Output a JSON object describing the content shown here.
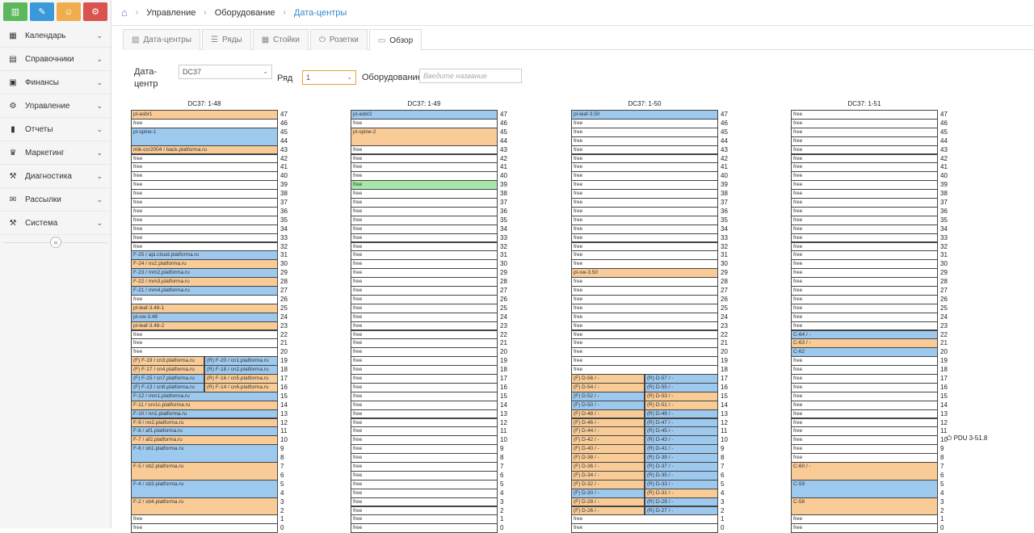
{
  "shortcuts": [
    {
      "icon": "chart-icon",
      "color": "#5cb85c"
    },
    {
      "icon": "pencil-icon",
      "color": "#3a9ad9"
    },
    {
      "icon": "users-icon",
      "color": "#f0ad4e"
    },
    {
      "icon": "gears-icon",
      "color": "#d9534f"
    }
  ],
  "sidebar": {
    "items": [
      {
        "label": "Календарь",
        "icon": "calendar-icon"
      },
      {
        "label": "Справочники",
        "icon": "book-icon"
      },
      {
        "label": "Финансы",
        "icon": "money-icon"
      },
      {
        "label": "Управление",
        "icon": "cogs-icon"
      },
      {
        "label": "Отчеты",
        "icon": "bar-chart-icon"
      },
      {
        "label": "Маркетинг",
        "icon": "trophy-icon"
      },
      {
        "label": "Диагностика",
        "icon": "gavel-icon"
      },
      {
        "label": "Рассылки",
        "icon": "envelope-icon"
      },
      {
        "label": "Система",
        "icon": "wrench-icon"
      }
    ],
    "collapse": "«"
  },
  "breadcrumb": [
    "Управление",
    "Оборудование",
    "Дата-центры"
  ],
  "tabs": [
    {
      "label": "Дата-центры",
      "icon": "image-icon"
    },
    {
      "label": "Ряды",
      "icon": "list-icon"
    },
    {
      "label": "Стойки",
      "icon": "grid-icon"
    },
    {
      "label": "Розетки",
      "icon": "power-icon"
    },
    {
      "label": "Обзор",
      "icon": "monitor-icon",
      "active": true
    }
  ],
  "filters": {
    "dc_label": "Дата-",
    "dc_label2": "центр",
    "dc_value": "DC37",
    "row_label": "Ряд",
    "row_value": "1",
    "equip_label": "Оборудование",
    "equip_placeholder": "Введите название"
  },
  "racks": [
    {
      "title": "DC37: 1-48",
      "units": [
        {
          "n": 47,
          "t": "pl-asbr1",
          "c": "orange"
        },
        {
          "n": 46,
          "t": "free",
          "c": "free"
        },
        {
          "n": 45,
          "t": "pl-spine-1",
          "c": "blue",
          "span": 2
        },
        {
          "n": 43,
          "t": "mik-ccr2004 / back.platforma.ru",
          "c": "orange"
        },
        {
          "n": 42,
          "t": "free",
          "c": "free"
        },
        {
          "n": 41,
          "t": "free",
          "c": "free"
        },
        {
          "n": 40,
          "t": "free",
          "c": "free"
        },
        {
          "n": 39,
          "t": "free",
          "c": "free"
        },
        {
          "n": 38,
          "t": "free",
          "c": "free"
        },
        {
          "n": 37,
          "t": "free",
          "c": "free"
        },
        {
          "n": 36,
          "t": "free",
          "c": "free"
        },
        {
          "n": 35,
          "t": "free",
          "c": "free"
        },
        {
          "n": 34,
          "t": "free",
          "c": "free"
        },
        {
          "n": 33,
          "t": "free",
          "c": "free"
        },
        {
          "n": 32,
          "t": "free",
          "c": "free"
        },
        {
          "n": 31,
          "t": "F-25 / api.cloud.platforma.ru",
          "c": "blue"
        },
        {
          "n": 30,
          "t": "F-24 / ns2.platforma.ru",
          "c": "orange"
        },
        {
          "n": 29,
          "t": "F-23 / mm2.platforma.ru",
          "c": "blue"
        },
        {
          "n": 28,
          "t": "F-22 / mm3.platforma.ru",
          "c": "orange"
        },
        {
          "n": 27,
          "t": "F-21 / mm4.platforma.ru",
          "c": "blue"
        },
        {
          "n": 26,
          "t": "free",
          "c": "free"
        },
        {
          "n": 25,
          "t": "pl-leaf-3.48-1",
          "c": "orange"
        },
        {
          "n": 24,
          "t": "pl-sw-3.48",
          "c": "blue"
        },
        {
          "n": 23,
          "t": "pl-leaf-3.48-2",
          "c": "orange"
        },
        {
          "n": 22,
          "t": "free",
          "c": "free"
        },
        {
          "n": 21,
          "t": "free",
          "c": "free"
        },
        {
          "n": 20,
          "t": "free",
          "c": "free"
        },
        {
          "n": 19,
          "t": "(F) F-19 / cn3.platforma.ru",
          "c": "orange",
          "r": "(R) F-20 / cn1.platforma.ru",
          "rc": "blue"
        },
        {
          "n": 18,
          "t": "(F) F-17 / cn4.platforma.ru",
          "c": "orange",
          "r": "(R) F-18 / cn2.platforma.ru",
          "rc": "blue"
        },
        {
          "n": 17,
          "t": "(F) F-15 / cn7.platforma.ru",
          "c": "blue",
          "r": "(R) F-16 / cn5.platforma.ru",
          "rc": "orange"
        },
        {
          "n": 16,
          "t": "(F) F-13 / cn8.platforma.ru",
          "c": "blue",
          "r": "(R) F-14 / cn6.platforma.ru",
          "rc": "orange"
        },
        {
          "n": 15,
          "t": "F-12 / mm1.platforma.ru",
          "c": "blue"
        },
        {
          "n": 14,
          "t": "F-11 / srv1c.platforma.ru",
          "c": "orange"
        },
        {
          "n": 13,
          "t": "F-10 / nn1.platforma.ru",
          "c": "blue"
        },
        {
          "n": 12,
          "t": "F-9 / nn2.platforma.ru",
          "c": "orange"
        },
        {
          "n": 11,
          "t": "F-8 / af1.platforma.ru",
          "c": "blue"
        },
        {
          "n": 10,
          "t": "F-7 / af2.platforma.ru",
          "c": "orange"
        },
        {
          "n": 9,
          "t": "F-6 / sb1.platforma.ru",
          "c": "blue",
          "span": 2
        },
        {
          "n": 7,
          "t": "F-5 / sb2.platforma.ru",
          "c": "orange",
          "span": 2
        },
        {
          "n": 5,
          "t": "F-4 / sb3.platforma.ru",
          "c": "blue",
          "span": 2
        },
        {
          "n": 3,
          "t": "F-2 / sb4.platforma.ru",
          "c": "orange",
          "span": 2
        },
        {
          "n": 1,
          "t": "free",
          "c": "free"
        },
        {
          "n": 0,
          "t": "free",
          "c": "free"
        }
      ]
    },
    {
      "title": "DC37: 1-49",
      "units": [
        {
          "n": 47,
          "t": "pl-asbr2",
          "c": "blue"
        },
        {
          "n": 46,
          "t": "free",
          "c": "free"
        },
        {
          "n": 45,
          "t": "pl-spine-2",
          "c": "orange",
          "span": 2
        },
        {
          "n": 43,
          "t": "free",
          "c": "free"
        },
        {
          "n": 42,
          "t": "free",
          "c": "free"
        },
        {
          "n": 41,
          "t": "free",
          "c": "free"
        },
        {
          "n": 40,
          "t": "free",
          "c": "free"
        },
        {
          "n": 39,
          "t": "free",
          "c": "green"
        },
        {
          "n": 38,
          "t": "free",
          "c": "free"
        },
        {
          "n": 37,
          "t": "free",
          "c": "free"
        },
        {
          "n": 36,
          "t": "free",
          "c": "free"
        },
        {
          "n": 35,
          "t": "free",
          "c": "free"
        },
        {
          "n": 34,
          "t": "free",
          "c": "free"
        },
        {
          "n": 33,
          "t": "free",
          "c": "free"
        },
        {
          "n": 32,
          "t": "free",
          "c": "free"
        },
        {
          "n": 31,
          "t": "free",
          "c": "free"
        },
        {
          "n": 30,
          "t": "free",
          "c": "free"
        },
        {
          "n": 29,
          "t": "free",
          "c": "free"
        },
        {
          "n": 28,
          "t": "free",
          "c": "free"
        },
        {
          "n": 27,
          "t": "free",
          "c": "free"
        },
        {
          "n": 26,
          "t": "free",
          "c": "free"
        },
        {
          "n": 25,
          "t": "free",
          "c": "free"
        },
        {
          "n": 24,
          "t": "free",
          "c": "free"
        },
        {
          "n": 23,
          "t": "free",
          "c": "free"
        },
        {
          "n": 22,
          "t": "free",
          "c": "free"
        },
        {
          "n": 21,
          "t": "free",
          "c": "free"
        },
        {
          "n": 20,
          "t": "free",
          "c": "free"
        },
        {
          "n": 19,
          "t": "free",
          "c": "free"
        },
        {
          "n": 18,
          "t": "free",
          "c": "free"
        },
        {
          "n": 17,
          "t": "free",
          "c": "free"
        },
        {
          "n": 16,
          "t": "free",
          "c": "free"
        },
        {
          "n": 15,
          "t": "free",
          "c": "free"
        },
        {
          "n": 14,
          "t": "free",
          "c": "free"
        },
        {
          "n": 13,
          "t": "free",
          "c": "free"
        },
        {
          "n": 12,
          "t": "free",
          "c": "free"
        },
        {
          "n": 11,
          "t": "free",
          "c": "free"
        },
        {
          "n": 10,
          "t": "free",
          "c": "free"
        },
        {
          "n": 9,
          "t": "free",
          "c": "free"
        },
        {
          "n": 8,
          "t": "free",
          "c": "free"
        },
        {
          "n": 7,
          "t": "free",
          "c": "free"
        },
        {
          "n": 6,
          "t": "free",
          "c": "free"
        },
        {
          "n": 5,
          "t": "free",
          "c": "free"
        },
        {
          "n": 4,
          "t": "free",
          "c": "free"
        },
        {
          "n": 3,
          "t": "free",
          "c": "free"
        },
        {
          "n": 2,
          "t": "free",
          "c": "free"
        },
        {
          "n": 1,
          "t": "free",
          "c": "free"
        },
        {
          "n": 0,
          "t": "free",
          "c": "free"
        }
      ]
    },
    {
      "title": "DC37: 1-50",
      "units": [
        {
          "n": 47,
          "t": "pl-leaf-3.50",
          "c": "blue"
        },
        {
          "n": 46,
          "t": "free",
          "c": "free"
        },
        {
          "n": 45,
          "t": "free",
          "c": "free"
        },
        {
          "n": 44,
          "t": "free",
          "c": "free"
        },
        {
          "n": 43,
          "t": "free",
          "c": "free"
        },
        {
          "n": 42,
          "t": "free",
          "c": "free"
        },
        {
          "n": 41,
          "t": "free",
          "c": "free"
        },
        {
          "n": 40,
          "t": "free",
          "c": "free"
        },
        {
          "n": 39,
          "t": "free",
          "c": "free"
        },
        {
          "n": 38,
          "t": "free",
          "c": "free"
        },
        {
          "n": 37,
          "t": "free",
          "c": "free"
        },
        {
          "n": 36,
          "t": "free",
          "c": "free"
        },
        {
          "n": 35,
          "t": "free",
          "c": "free"
        },
        {
          "n": 34,
          "t": "free",
          "c": "free"
        },
        {
          "n": 33,
          "t": "free",
          "c": "free"
        },
        {
          "n": 32,
          "t": "free",
          "c": "free"
        },
        {
          "n": 31,
          "t": "free",
          "c": "free"
        },
        {
          "n": 30,
          "t": "free",
          "c": "free"
        },
        {
          "n": 29,
          "t": "pl-sw-3.50",
          "c": "orange"
        },
        {
          "n": 28,
          "t": "free",
          "c": "free"
        },
        {
          "n": 27,
          "t": "free",
          "c": "free"
        },
        {
          "n": 26,
          "t": "free",
          "c": "free"
        },
        {
          "n": 25,
          "t": "free",
          "c": "free"
        },
        {
          "n": 24,
          "t": "free",
          "c": "free"
        },
        {
          "n": 23,
          "t": "free",
          "c": "free"
        },
        {
          "n": 22,
          "t": "free",
          "c": "free"
        },
        {
          "n": 21,
          "t": "free",
          "c": "free"
        },
        {
          "n": 20,
          "t": "free",
          "c": "free"
        },
        {
          "n": 19,
          "t": "free",
          "c": "free"
        },
        {
          "n": 18,
          "t": "free",
          "c": "free"
        },
        {
          "n": 17,
          "t": "(F) D-56 / -",
          "c": "orange",
          "r": "(R) D-57 / -",
          "rc": "blue"
        },
        {
          "n": 16,
          "t": "(F) D-54 / -",
          "c": "orange",
          "r": "(R) D-55 / -",
          "rc": "blue"
        },
        {
          "n": 15,
          "t": "(F) D-52 / -",
          "c": "blue",
          "r": "(R) D-53 / -",
          "rc": "orange"
        },
        {
          "n": 14,
          "t": "(F) D-50 / -",
          "c": "blue",
          "r": "(R) D-51 / -",
          "rc": "orange"
        },
        {
          "n": 13,
          "t": "(F) D-48 / -",
          "c": "orange",
          "r": "(R) D-49 / -",
          "rc": "blue"
        },
        {
          "n": 12,
          "t": "(F) D-46 / -",
          "c": "orange",
          "r": "(R) D-47 / -",
          "rc": "blue"
        },
        {
          "n": 11,
          "t": "(F) D-44 / -",
          "c": "orange",
          "r": "(R) D-45 / -",
          "rc": "blue"
        },
        {
          "n": 10,
          "t": "(F) D-42 / -",
          "c": "orange",
          "r": "(R) D-43 / -",
          "rc": "blue"
        },
        {
          "n": 9,
          "t": "(F) D-40 / -",
          "c": "orange",
          "r": "(R) D-41 / -",
          "rc": "blue"
        },
        {
          "n": 8,
          "t": "(F) D-38 / -",
          "c": "orange",
          "r": "(R) D-39 / -",
          "rc": "blue"
        },
        {
          "n": 7,
          "t": "(F) D-36 / -",
          "c": "orange",
          "r": "(R) D-37 / -",
          "rc": "blue"
        },
        {
          "n": 6,
          "t": "(F) D-34 / -",
          "c": "orange",
          "r": "(R) D-35 / -",
          "rc": "blue"
        },
        {
          "n": 5,
          "t": "(F) D-32 / -",
          "c": "orange",
          "r": "(R) D-33 / -",
          "rc": "blue"
        },
        {
          "n": 4,
          "t": "(F) D-30 / -",
          "c": "blue",
          "r": "(R) D-31 / -",
          "rc": "orange"
        },
        {
          "n": 3,
          "t": "(F) D-28 / -",
          "c": "orange",
          "r": "(R) D-29 / -",
          "rc": "blue"
        },
        {
          "n": 2,
          "t": "(F) D-26 / -",
          "c": "orange",
          "r": "(R) D-27 / -",
          "rc": "blue"
        },
        {
          "n": 1,
          "t": "free",
          "c": "free"
        },
        {
          "n": 0,
          "t": "free",
          "c": "free"
        }
      ]
    },
    {
      "title": "DC37: 1-51",
      "units": [
        {
          "n": 47,
          "t": "free",
          "c": "free"
        },
        {
          "n": 46,
          "t": "free",
          "c": "free"
        },
        {
          "n": 45,
          "t": "free",
          "c": "free"
        },
        {
          "n": 44,
          "t": "free",
          "c": "free"
        },
        {
          "n": 43,
          "t": "free",
          "c": "free"
        },
        {
          "n": 42,
          "t": "free",
          "c": "free"
        },
        {
          "n": 41,
          "t": "free",
          "c": "free"
        },
        {
          "n": 40,
          "t": "free",
          "c": "free"
        },
        {
          "n": 39,
          "t": "free",
          "c": "free"
        },
        {
          "n": 38,
          "t": "free",
          "c": "free"
        },
        {
          "n": 37,
          "t": "free",
          "c": "free"
        },
        {
          "n": 36,
          "t": "free",
          "c": "free"
        },
        {
          "n": 35,
          "t": "free",
          "c": "free"
        },
        {
          "n": 34,
          "t": "free",
          "c": "free"
        },
        {
          "n": 33,
          "t": "free",
          "c": "free"
        },
        {
          "n": 32,
          "t": "free",
          "c": "free"
        },
        {
          "n": 31,
          "t": "free",
          "c": "free"
        },
        {
          "n": 30,
          "t": "free",
          "c": "free"
        },
        {
          "n": 29,
          "t": "free",
          "c": "free"
        },
        {
          "n": 28,
          "t": "free",
          "c": "free"
        },
        {
          "n": 27,
          "t": "free",
          "c": "free"
        },
        {
          "n": 26,
          "t": "free",
          "c": "free"
        },
        {
          "n": 25,
          "t": "free",
          "c": "free"
        },
        {
          "n": 24,
          "t": "free",
          "c": "free"
        },
        {
          "n": 23,
          "t": "free",
          "c": "free"
        },
        {
          "n": 22,
          "t": "C-64 / -",
          "c": "blue"
        },
        {
          "n": 21,
          "t": "C-63 / -",
          "c": "orange"
        },
        {
          "n": 20,
          "t": "C-62",
          "c": "blue"
        },
        {
          "n": 19,
          "t": "free",
          "c": "free"
        },
        {
          "n": 18,
          "t": "free",
          "c": "free"
        },
        {
          "n": 17,
          "t": "free",
          "c": "free"
        },
        {
          "n": 16,
          "t": "free",
          "c": "free"
        },
        {
          "n": 15,
          "t": "free",
          "c": "free"
        },
        {
          "n": 14,
          "t": "free",
          "c": "free"
        },
        {
          "n": 13,
          "t": "free",
          "c": "free"
        },
        {
          "n": 12,
          "t": "free",
          "c": "free"
        },
        {
          "n": 11,
          "t": "free",
          "c": "free"
        },
        {
          "n": 10,
          "t": "free",
          "c": "free"
        },
        {
          "n": 9,
          "t": "free",
          "c": "free"
        },
        {
          "n": 8,
          "t": "free",
          "c": "free"
        },
        {
          "n": 7,
          "t": "C-60 / -",
          "c": "orange",
          "span": 2
        },
        {
          "n": 5,
          "t": "C-59",
          "c": "blue",
          "span": 2
        },
        {
          "n": 3,
          "t": "C-58",
          "c": "orange",
          "span": 2
        },
        {
          "n": 1,
          "t": "free",
          "c": "free"
        },
        {
          "n": 0,
          "t": "free",
          "c": "free"
        }
      ]
    }
  ],
  "pdu": {
    "label": "PDU 3-51.8",
    "icon": "plug-icon",
    "unit": 10
  }
}
